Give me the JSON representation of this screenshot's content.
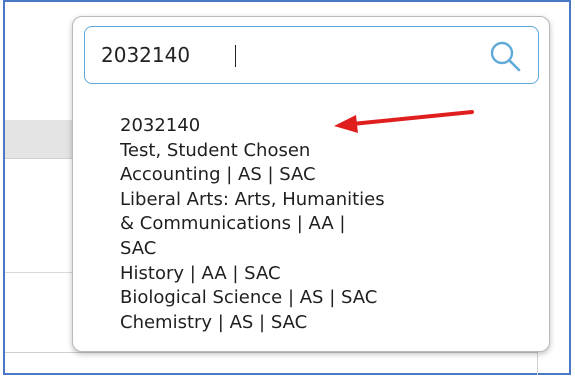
{
  "search": {
    "value": "2032140"
  },
  "results": [
    "2032140",
    "Test, Student Chosen",
    "Accounting | AS | SAC",
    "Liberal Arts: Arts, Humanities",
    "& Communications | AA |",
    "SAC",
    "History | AA | SAC",
    "Biological Science | AS | SAC",
    "Chemistry | AS | SAC"
  ],
  "colors": {
    "accent": "#5fa9d8",
    "annotation_arrow": "#e01e1e",
    "frame": "#4a78c4"
  },
  "icons": {
    "search": "search-icon",
    "annotation": "red-arrow-icon"
  }
}
